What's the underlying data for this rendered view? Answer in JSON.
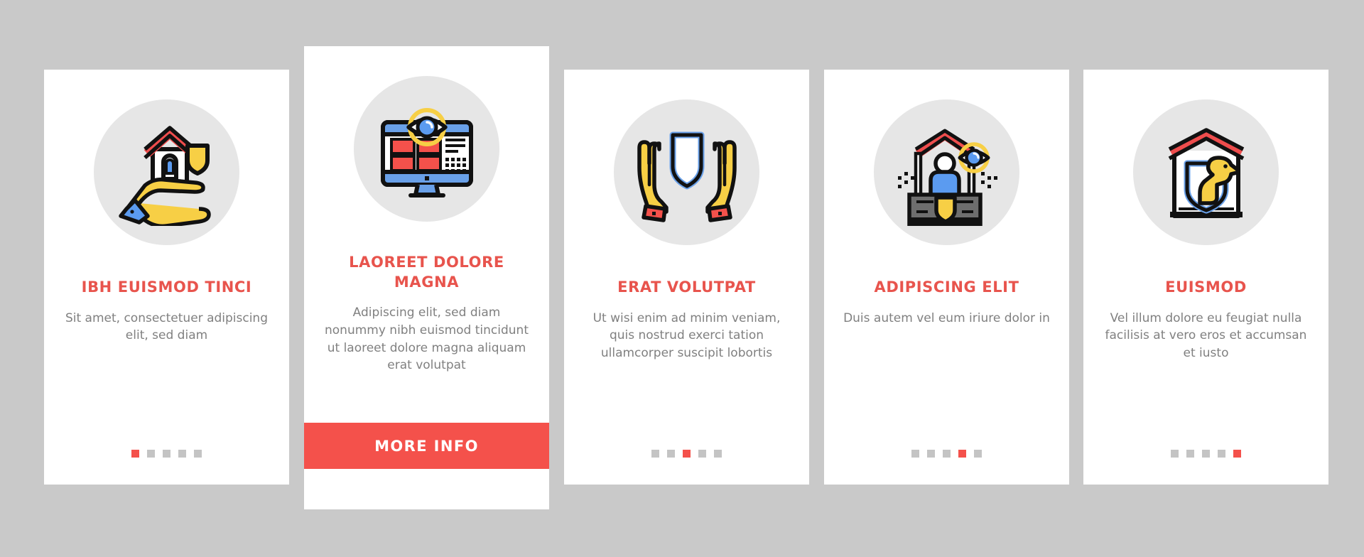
{
  "page": {
    "background_color": "#c9c9c9",
    "accent_color": "#e8544d",
    "button_color": "#f4514b",
    "card_background": "#ffffff",
    "icon_circle_color": "#e6e6e6",
    "body_text_color": "#808080",
    "dot_inactive_color": "#c4c4c4"
  },
  "cards": [
    {
      "icon_name": "hand-holding-house-shield-icon",
      "title": "IBH EUISMOD TINCI",
      "body": "Sit amet, consectetuer adipiscing elit, sed diam",
      "dots": {
        "count": 5,
        "active_index": 0
      },
      "featured": false
    },
    {
      "icon_name": "monitor-surveillance-eye-icon",
      "title": "LAOREET DOLORE MAGNA",
      "body": "Adipiscing elit, sed diam nonummy nibh euismod tincidunt ut laoreet dolore magna aliquam erat volutpat",
      "dots": null,
      "featured": true,
      "button_label": "MORE INFO"
    },
    {
      "icon_name": "hands-protecting-shield-icon",
      "title": "ERAT VOLUTPAT",
      "body": "Ut wisi enim ad minim veniam, quis nostrud exerci tation ullamcorper suscipit lobortis",
      "dots": {
        "count": 5,
        "active_index": 2
      },
      "featured": false
    },
    {
      "icon_name": "person-under-roof-surveillance-icon",
      "title": "ADIPISCING ELIT",
      "body": "Duis autem vel eum iriure dolor in",
      "dots": {
        "count": 5,
        "active_index": 3
      },
      "featured": false
    },
    {
      "icon_name": "house-shield-guard-dog-icon",
      "title": "EUISMOD",
      "body": "Vel illum dolore eu feugiat nulla facilisis at vero eros et accumsan et iusto",
      "dots": {
        "count": 5,
        "active_index": 4
      },
      "featured": false
    }
  ]
}
